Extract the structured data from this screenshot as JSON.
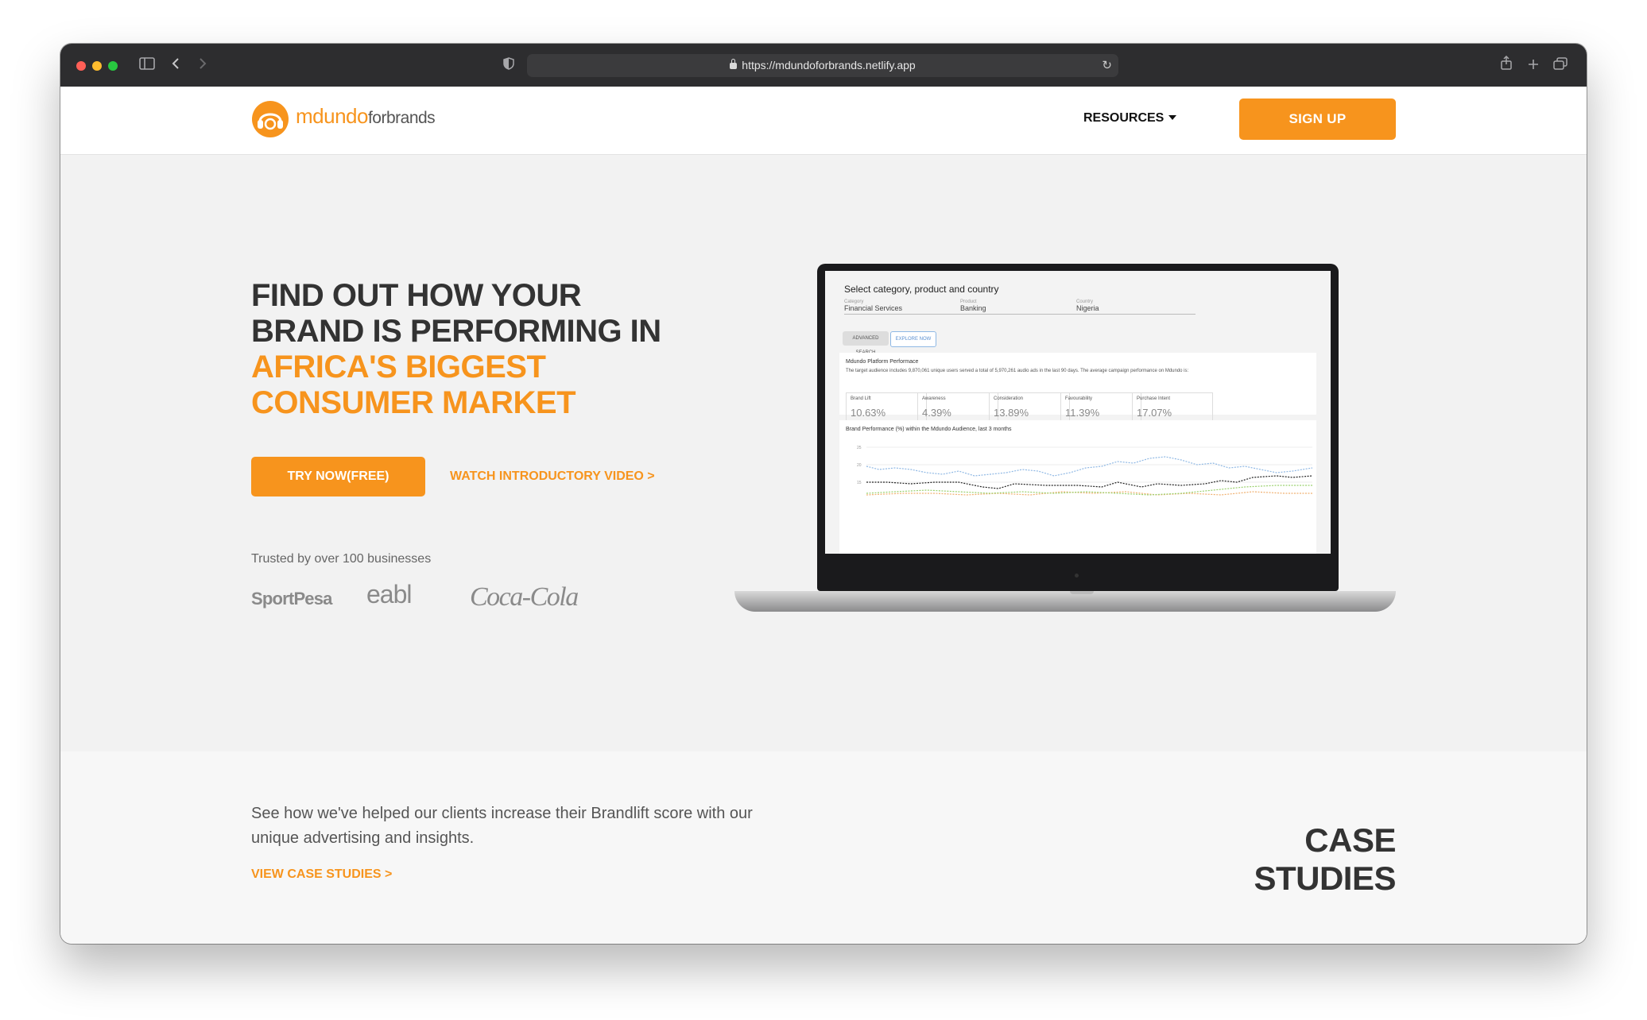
{
  "browser": {
    "url": "https://mdundoforbrands.netlify.app"
  },
  "header": {
    "logo_main": "mdundo",
    "logo_sub": "forbrands",
    "resources_label": "RESOURCES",
    "signup_label": "SIGN UP"
  },
  "hero": {
    "headline_line1": "FIND OUT HOW YOUR",
    "headline_line2": "BRAND IS PERFORMING IN",
    "headline_line3": "AFRICA'S BIGGEST",
    "headline_line4": "CONSUMER MARKET",
    "try_label": "TRY NOW(FREE)",
    "watch_label": "WATCH INTRODUCTORY VIDEO >",
    "trusted_text": "Trusted by over 100 businesses",
    "partners": [
      "SportPesa",
      "eabl",
      "Coca-Cola"
    ]
  },
  "dashboard": {
    "title": "Select category, product and country",
    "category_label": "Category",
    "category_value": "Financial Services",
    "product_label": "Product",
    "product_value": "Banking",
    "country_label": "Country",
    "country_value": "Nigeria",
    "advanced_search": "ADVANCED SEARCH",
    "explore_now": "EXPLORE NOW",
    "performance_title": "Mdundo Platform Performace",
    "performance_desc": "The target audience includes 9,870,061 unique users served a total of 5,970,261 audio ads in the last 90 days. The average campaign performance on Mdundo is:",
    "metrics": [
      {
        "label": "Brand Lift",
        "value": "10.63%"
      },
      {
        "label": "Awareness",
        "value": "4.39%"
      },
      {
        "label": "Consideration",
        "value": "13.89%"
      },
      {
        "label": "Favourability",
        "value": "11.39%"
      },
      {
        "label": "Purchase Intent",
        "value": "17.07%"
      }
    ],
    "chart_title": "Brand Performance (%) within the Mdundo Audience, last 3 months",
    "y_ticks": [
      "25",
      "20",
      "15"
    ],
    "colors": {
      "blue": "#8fb8e4",
      "black": "#222222",
      "green": "#9bd16e",
      "orange": "#f0b070"
    }
  },
  "case_studies": {
    "text": "See how we've helped our clients increase their Brandlift score with our unique advertising and insights.",
    "link": "VIEW CASE STUDIES >",
    "title": "CASE STUDIES"
  },
  "colors": {
    "accent": "#f7941d",
    "heading": "#333333"
  }
}
